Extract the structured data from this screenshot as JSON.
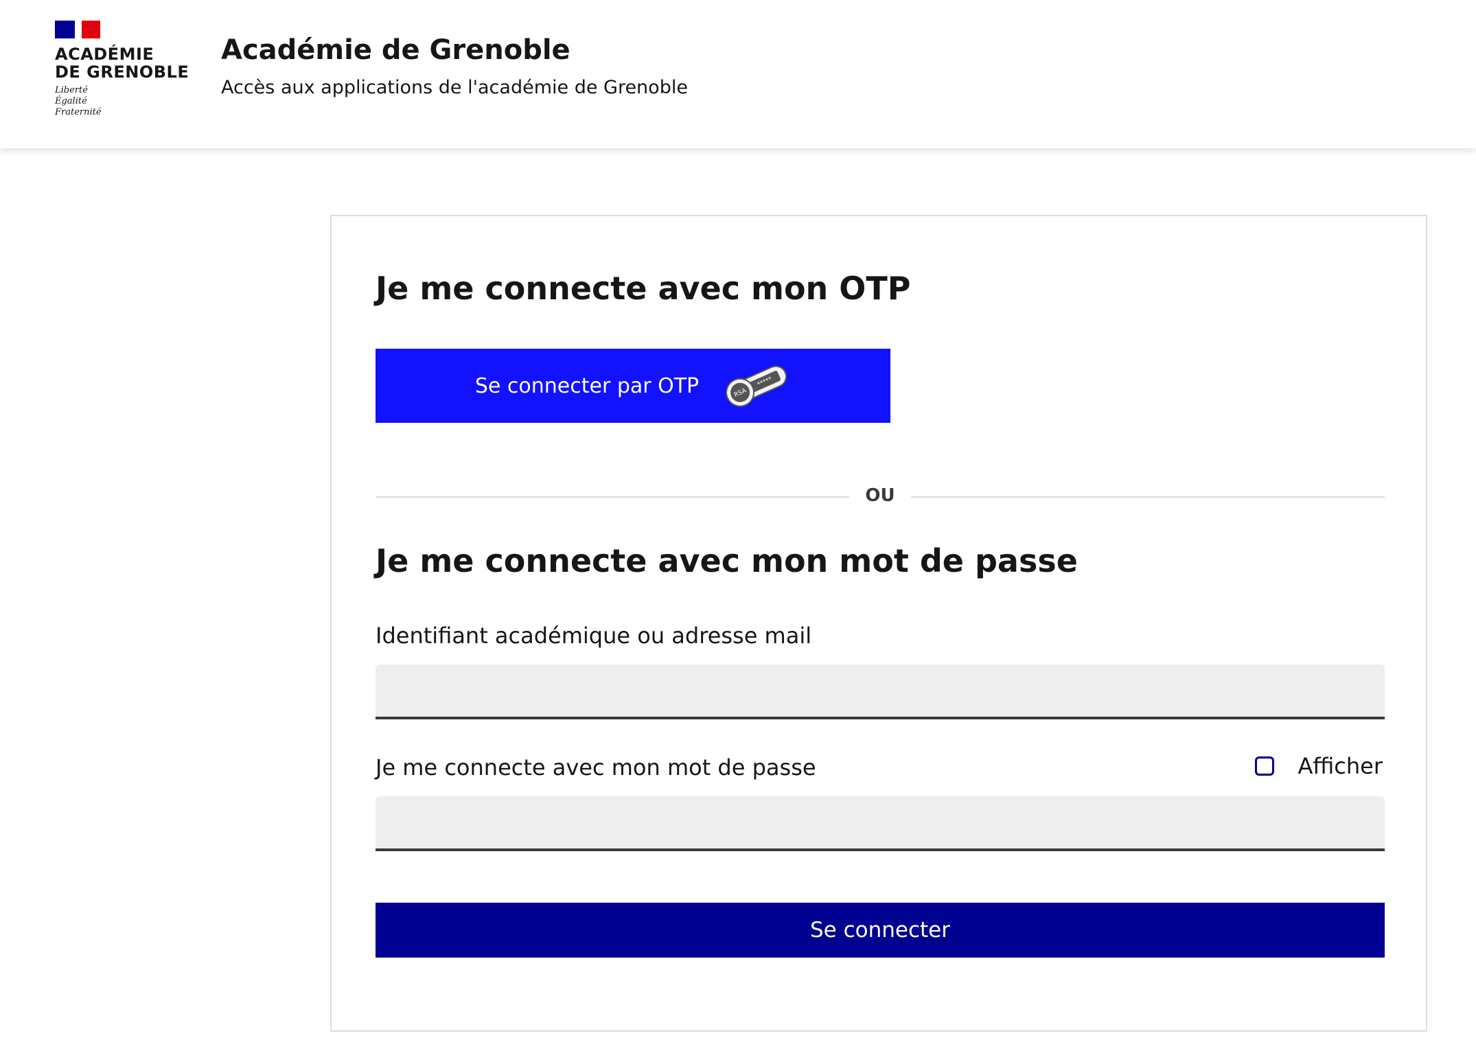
{
  "header": {
    "logo": {
      "name_line1": "ACADÉMIE",
      "name_line2": "DE GRENOBLE",
      "motto_line1": "Liberté",
      "motto_line2": "Égalité",
      "motto_line3": "Fraternité"
    },
    "title": "Académie de Grenoble",
    "subtitle": "Accès aux applications de l'académie de Grenoble"
  },
  "otp_section": {
    "heading": "Je me connecte avec mon OTP",
    "button_label": "Se connecter par OTP",
    "token_icon_text": "RSA"
  },
  "divider": {
    "text": "OU"
  },
  "password_section": {
    "heading": "Je me connecte avec mon mot de passe",
    "identifier_label": "Identifiant académique ou adresse mail",
    "identifier_value": "",
    "password_label": "Je me connecte avec mon mot de passe",
    "password_value": "",
    "show_password_label": "Afficher",
    "show_password_checked": false,
    "submit_label": "Se connecter"
  },
  "colors": {
    "otp_button": "#1212ff",
    "submit_button": "#000091",
    "checkbox_border": "#000091",
    "input_background": "#eeeeee"
  }
}
